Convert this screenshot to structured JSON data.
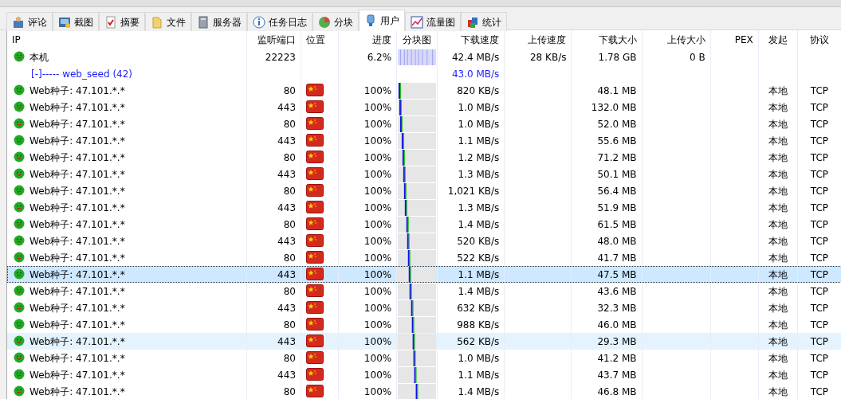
{
  "tabs": [
    {
      "label": "评论",
      "selected": false
    },
    {
      "label": "截图",
      "selected": false
    },
    {
      "label": "摘要",
      "selected": false
    },
    {
      "label": "文件",
      "selected": false
    },
    {
      "label": "服务器",
      "selected": false
    },
    {
      "label": "任务日志",
      "selected": false
    },
    {
      "label": "分块",
      "selected": false
    },
    {
      "label": "用户",
      "selected": true
    },
    {
      "label": "流量图",
      "selected": false
    },
    {
      "label": "统计",
      "selected": false
    }
  ],
  "table": {
    "columns": [
      "IP",
      "监听端口",
      "位置",
      "进度",
      "分块图",
      "下载速度",
      "上传速度",
      "下载大小",
      "上传大小",
      "PEX",
      "发起",
      "协议"
    ],
    "local": {
      "ip": "本机",
      "port": "22223",
      "progress": "6.2%",
      "down_speed": "42.4 MB/s",
      "up_speed": "28 KB/s",
      "down_size": "1.78 GB",
      "up_size": "0 B"
    },
    "group": {
      "label": "[-]----- web_seed (42)",
      "down_speed": "43.0 MB/s"
    },
    "rows": [
      {
        "ip": "Web种子: 47.101.*.*",
        "port": "80",
        "progress": "100%",
        "down_speed": "820 KB/s",
        "down_size": "48.1 MB",
        "origin": "本地",
        "protocol": "TCP",
        "selected": false,
        "hovered": false
      },
      {
        "ip": "Web种子: 47.101.*.*",
        "port": "443",
        "progress": "100%",
        "down_speed": "1.0 MB/s",
        "down_size": "132.0 MB",
        "origin": "本地",
        "protocol": "TCP",
        "selected": false,
        "hovered": false
      },
      {
        "ip": "Web种子: 47.101.*.*",
        "port": "80",
        "progress": "100%",
        "down_speed": "1.0 MB/s",
        "down_size": "52.0 MB",
        "origin": "本地",
        "protocol": "TCP",
        "selected": false,
        "hovered": false
      },
      {
        "ip": "Web种子: 47.101.*.*",
        "port": "443",
        "progress": "100%",
        "down_speed": "1.1 MB/s",
        "down_size": "55.6 MB",
        "origin": "本地",
        "protocol": "TCP",
        "selected": false,
        "hovered": false
      },
      {
        "ip": "Web种子: 47.101.*.*",
        "port": "80",
        "progress": "100%",
        "down_speed": "1.2 MB/s",
        "down_size": "71.2 MB",
        "origin": "本地",
        "protocol": "TCP",
        "selected": false,
        "hovered": false
      },
      {
        "ip": "Web种子: 47.101.*.*",
        "port": "443",
        "progress": "100%",
        "down_speed": "1.3 MB/s",
        "down_size": "50.1 MB",
        "origin": "本地",
        "protocol": "TCP",
        "selected": false,
        "hovered": false
      },
      {
        "ip": "Web种子: 47.101.*.*",
        "port": "80",
        "progress": "100%",
        "down_speed": "1,021 KB/s",
        "down_size": "56.4 MB",
        "origin": "本地",
        "protocol": "TCP",
        "selected": false,
        "hovered": false
      },
      {
        "ip": "Web种子: 47.101.*.*",
        "port": "443",
        "progress": "100%",
        "down_speed": "1.3 MB/s",
        "down_size": "51.9 MB",
        "origin": "本地",
        "protocol": "TCP",
        "selected": false,
        "hovered": false
      },
      {
        "ip": "Web种子: 47.101.*.*",
        "port": "80",
        "progress": "100%",
        "down_speed": "1.4 MB/s",
        "down_size": "61.5 MB",
        "origin": "本地",
        "protocol": "TCP",
        "selected": false,
        "hovered": false
      },
      {
        "ip": "Web种子: 47.101.*.*",
        "port": "443",
        "progress": "100%",
        "down_speed": "520 KB/s",
        "down_size": "48.0 MB",
        "origin": "本地",
        "protocol": "TCP",
        "selected": false,
        "hovered": false
      },
      {
        "ip": "Web种子: 47.101.*.*",
        "port": "80",
        "progress": "100%",
        "down_speed": "522 KB/s",
        "down_size": "41.7 MB",
        "origin": "本地",
        "protocol": "TCP",
        "selected": false,
        "hovered": false
      },
      {
        "ip": "Web种子: 47.101.*.*",
        "port": "443",
        "progress": "100%",
        "down_speed": "1.1 MB/s",
        "down_size": "47.5 MB",
        "origin": "本地",
        "protocol": "TCP",
        "selected": true,
        "hovered": false
      },
      {
        "ip": "Web种子: 47.101.*.*",
        "port": "80",
        "progress": "100%",
        "down_speed": "1.4 MB/s",
        "down_size": "43.6 MB",
        "origin": "本地",
        "protocol": "TCP",
        "selected": false,
        "hovered": false
      },
      {
        "ip": "Web种子: 47.101.*.*",
        "port": "443",
        "progress": "100%",
        "down_speed": "632 KB/s",
        "down_size": "32.3 MB",
        "origin": "本地",
        "protocol": "TCP",
        "selected": false,
        "hovered": false
      },
      {
        "ip": "Web种子: 47.101.*.*",
        "port": "80",
        "progress": "100%",
        "down_speed": "988 KB/s",
        "down_size": "46.0 MB",
        "origin": "本地",
        "protocol": "TCP",
        "selected": false,
        "hovered": false
      },
      {
        "ip": "Web种子: 47.101.*.*",
        "port": "443",
        "progress": "100%",
        "down_speed": "562 KB/s",
        "down_size": "29.3 MB",
        "origin": "本地",
        "protocol": "TCP",
        "selected": false,
        "hovered": true
      },
      {
        "ip": "Web种子: 47.101.*.*",
        "port": "80",
        "progress": "100%",
        "down_speed": "1.0 MB/s",
        "down_size": "41.2 MB",
        "origin": "本地",
        "protocol": "TCP",
        "selected": false,
        "hovered": false
      },
      {
        "ip": "Web种子: 47.101.*.*",
        "port": "443",
        "progress": "100%",
        "down_speed": "1.1 MB/s",
        "down_size": "43.7 MB",
        "origin": "本地",
        "protocol": "TCP",
        "selected": false,
        "hovered": false
      },
      {
        "ip": "Web种子: 47.101.*.*",
        "port": "80",
        "progress": "100%",
        "down_speed": "1.4 MB/s",
        "down_size": "46.8 MB",
        "origin": "本地",
        "protocol": "TCP",
        "selected": false,
        "hovered": false
      }
    ]
  }
}
